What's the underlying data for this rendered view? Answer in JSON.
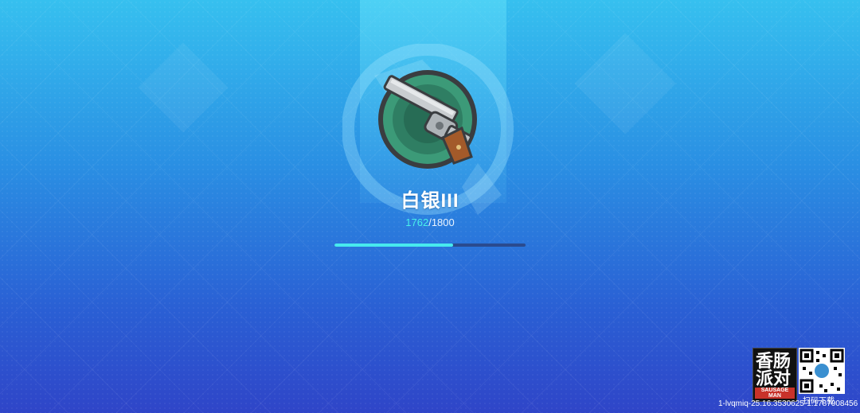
{
  "rank": {
    "title": "白银III",
    "icon": "revolver-icon"
  },
  "progress": {
    "current": "1762",
    "separator": "/",
    "total": "1800",
    "fraction": 0.62
  },
  "watermark": {
    "logo_line1": "香肠",
    "logo_line2": "派对",
    "logo_sub": "SAUSAGE MAN",
    "qr_label": "扫码下载",
    "code": "1-lvqmiq-25.16.3530625-1.1787008456"
  },
  "colors": {
    "progress_fill": "#47e9ee",
    "progress_track": "#2a4b8f",
    "current_value": "#48f0ea"
  }
}
